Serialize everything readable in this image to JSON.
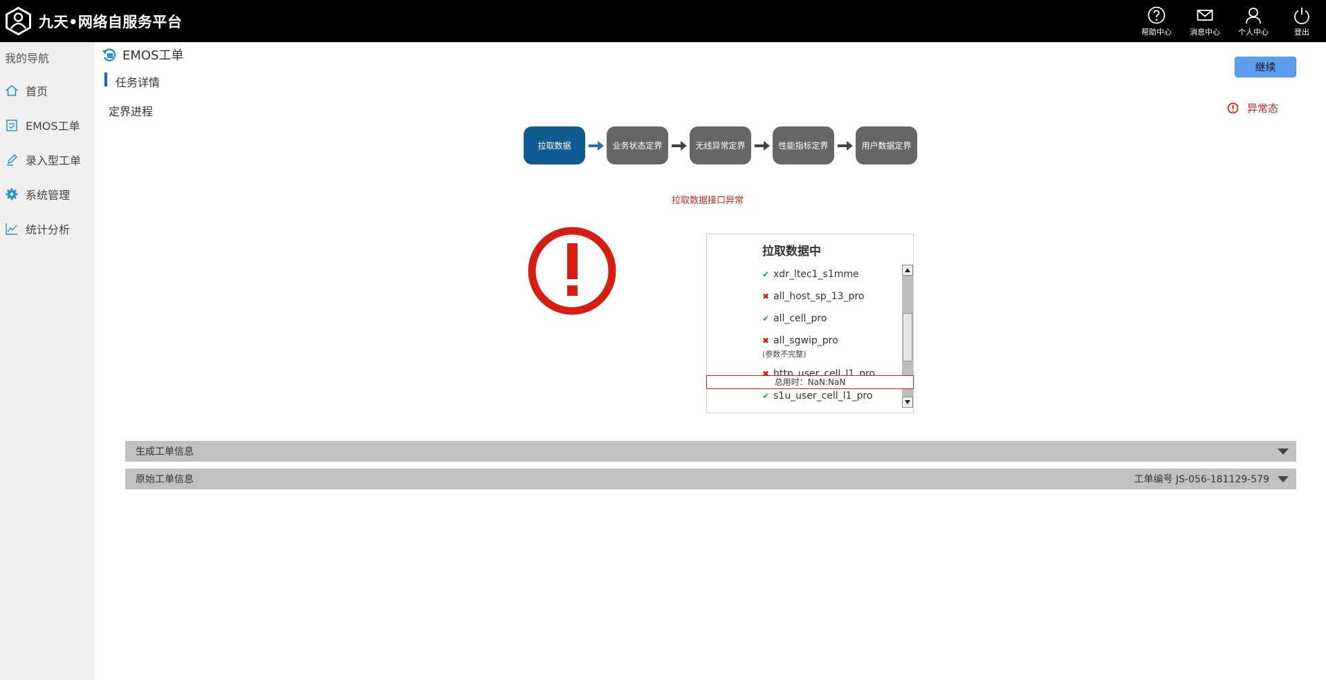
{
  "app": {
    "title": "九天•网络自服务平台"
  },
  "top_actions": [
    {
      "label": "帮助中心",
      "icon": "help-icon"
    },
    {
      "label": "消息中心",
      "icon": "mail-icon"
    },
    {
      "label": "个人中心",
      "icon": "user-icon"
    },
    {
      "label": "登出",
      "icon": "power-icon"
    }
  ],
  "sidebar": {
    "title": "我的导航",
    "items": [
      {
        "label": "首页",
        "icon": "home-icon"
      },
      {
        "label": "EMOS工单",
        "icon": "document-icon"
      },
      {
        "label": "录入型工单",
        "icon": "pen-icon"
      },
      {
        "label": "系统管理",
        "icon": "gear-icon"
      },
      {
        "label": "统计分析",
        "icon": "line-chart-icon"
      }
    ]
  },
  "main": {
    "page_title": "EMOS工单",
    "section_title": "任务详情",
    "continue_label": "继续",
    "progress_label": "定界进程",
    "status_label": "异常态",
    "steps": [
      "拉取数据",
      "业务状态定界",
      "无线异常定界",
      "性能指标定界",
      "用户数据定界"
    ],
    "active_step": 0,
    "error_message": "拉取数据接口异常",
    "panel": {
      "title": "拉取数据中",
      "tasks": [
        {
          "name": "xdr_ltec1_s1mme",
          "status": "ok",
          "note": ""
        },
        {
          "name": "all_host_sp_13_pro",
          "status": "fail",
          "note": ""
        },
        {
          "name": "all_cell_pro",
          "status": "ok",
          "note": ""
        },
        {
          "name": "all_sgwip_pro",
          "status": "fail",
          "note": "(参数不完整)"
        },
        {
          "name": "http_user_cell_l1_pro",
          "status": "fail",
          "note": ""
        },
        {
          "name": "s1u_user_cell_l1_pro",
          "status": "ok",
          "note": ""
        }
      ],
      "total_time": "总用时：NaN:NaN"
    },
    "accordions": [
      {
        "title": "生成工单信息",
        "order_no": ""
      },
      {
        "title": "原始工单信息",
        "order_no": "工单编号 JS-056-181129-579"
      }
    ]
  },
  "colors": {
    "accent": "#0d5b91",
    "error": "#c8281c",
    "button": "#5c9ff2",
    "step_inactive": "#666666"
  }
}
